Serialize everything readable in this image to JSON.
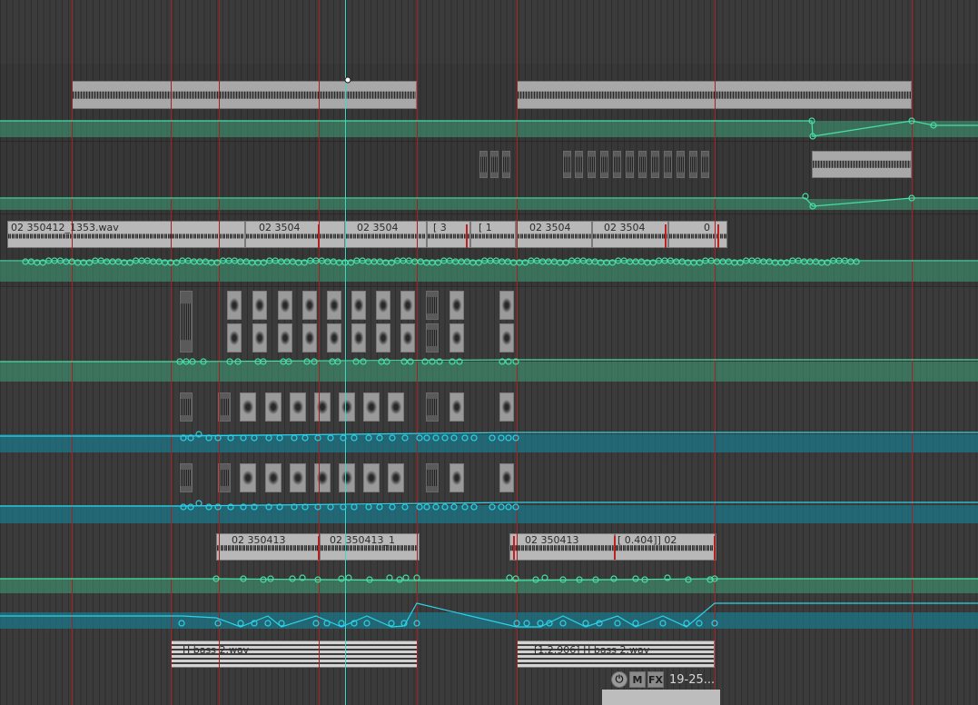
{
  "colors": {
    "envelope_green": "#47e0a6",
    "envelope_blue": "#2cd2e8",
    "marker_red": "#a52020",
    "item_gray": "#b8b8b8"
  },
  "tracks": {
    "track3": {
      "item_labels": [
        "02 350412_1353.wav",
        "02 3504",
        "02 3504",
        "[ 3",
        "[ 1",
        "02 3504",
        "02 3504",
        "0"
      ]
    },
    "track9": {
      "item_labels": [
        "02 350413",
        "02 350413_1",
        "02 350413",
        "[ 0.404]] 02"
      ]
    },
    "track11": {
      "item_labels": [
        "H bass 2.wav",
        "[1.2.906] H bass 2.wav"
      ]
    }
  },
  "item_controls": {
    "power_icon": "power-icon",
    "mute_label": "M",
    "fx_label": "FX",
    "item_name": "19-25..."
  }
}
